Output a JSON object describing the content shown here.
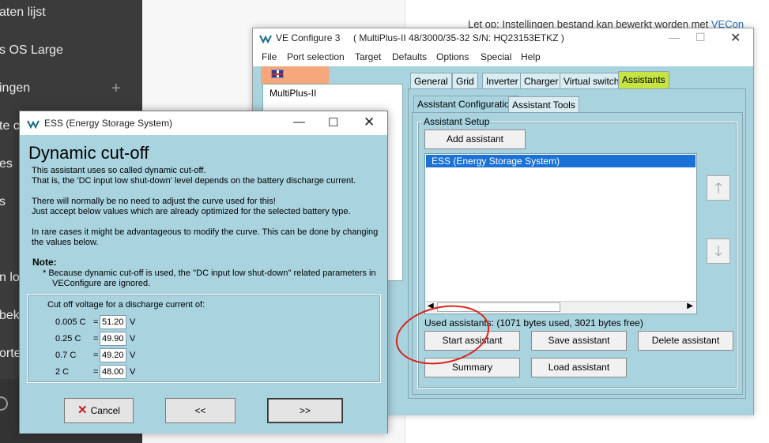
{
  "sidebar": {
    "items": [
      {
        "label": "aten lijst"
      },
      {
        "label": "s OS Large"
      },
      {
        "label": "ingen"
      },
      {
        "label": "te c"
      },
      {
        "label": "es"
      },
      {
        "label": "s"
      },
      {
        "label": "n log"
      },
      {
        "label": "beke"
      },
      {
        "label": "orte"
      }
    ]
  },
  "note": {
    "text": "Let op: Instellingen bestand kan bewerkt worden met ",
    "link": "VECon"
  },
  "veconfigure": {
    "title": "VE Configure 3     ( MultiPlus-II 48/3000/35-32 S/N: HQ23153ETKZ )",
    "menu": [
      "File",
      "Port selection",
      "Target",
      "Defaults",
      "Options",
      "Special",
      "Help"
    ],
    "device_label": "MultiPlus-II",
    "tabs": [
      "General",
      "Grid",
      "Inverter",
      "Charger",
      "Virtual switch",
      "Assistants"
    ],
    "subtabs": [
      "Assistant Configuration",
      "Assistant Tools"
    ],
    "group_label": "Assistant Setup",
    "add_assistant": "Add assistant",
    "list_items": [
      "ESS (Energy Storage System)"
    ],
    "used_text": "Used assistants: (1071 bytes used, 3021 bytes free)",
    "buttons": {
      "start": "Start assistant",
      "save": "Save assistant",
      "delete": "Delete assistant",
      "summary": "Summary",
      "load": "Load assistant"
    },
    "arrow_up": "🡑",
    "arrow_down": "🡓"
  },
  "ess_dialog": {
    "title": "ESS (Energy Storage System)",
    "heading": "Dynamic cut-off",
    "lines": [
      "This assistant uses so called dynamic cut-off.",
      "That is, the  'DC input low shut-down' level depends on the battery discharge current.",
      "There will normally be no need to adjust the curve used for this!",
      "Just accept below values which are already optimized for the selected battery type.",
      "In rare cases it might be advantageous to modify the curve. This can be done by changing",
      "the values below."
    ],
    "note_label": "Note:",
    "note_lines": [
      "*   Because dynamic cut-off is used, the ''DC input low shut-down'' related parameters in",
      "VEConfigure are ignored."
    ],
    "cutoff_caption": "Cut off voltage for a discharge current of:",
    "cutoff_rows": [
      {
        "c": "0.005 C",
        "eq": "=",
        "value": "51.20",
        "unit": "V"
      },
      {
        "c": "0.25 C",
        "eq": "=",
        "value": "49.90",
        "unit": "V"
      },
      {
        "c": "0.7 C",
        "eq": "=",
        "value": "49.20",
        "unit": "V"
      },
      {
        "c": "2 C",
        "eq": "=",
        "value": "48.00",
        "unit": "V"
      }
    ],
    "cancel": "Cancel",
    "prev": "<<",
    "next": ">>"
  }
}
